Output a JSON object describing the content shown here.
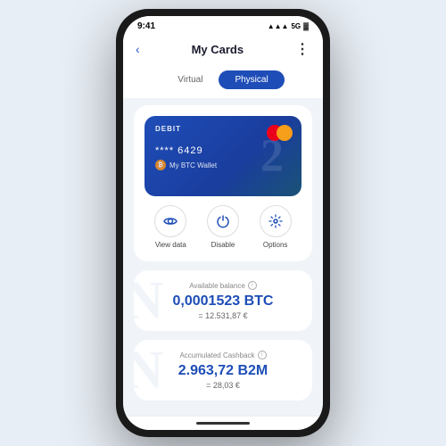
{
  "statusBar": {
    "time": "9:41",
    "signal": "●●●",
    "network": "5G",
    "battery": "▮▮▮"
  },
  "header": {
    "back": "‹",
    "title": "My Cards",
    "menu": "⋮"
  },
  "tabs": {
    "virtual": "Virtual",
    "physical": "Physical",
    "activeTab": "physical"
  },
  "card": {
    "type": "DEBIT",
    "watermark": "2",
    "number": "**** 6429",
    "wallet": "My BTC Wallet"
  },
  "actions": [
    {
      "id": "view-data",
      "label": "View data",
      "icon": "👁"
    },
    {
      "id": "disable",
      "label": "Disable",
      "icon": "⏻"
    },
    {
      "id": "options",
      "label": "Options",
      "icon": "⚙"
    }
  ],
  "availableBalance": {
    "label": "Available balance",
    "amount": "0,0001523 BTC",
    "eur": "= 12.531,87 €",
    "watermark": "N"
  },
  "cashback": {
    "label": "Accumulated Cashback",
    "amount": "2.963,72 B2M",
    "eur": "= 28,03 €",
    "watermark": "N"
  }
}
